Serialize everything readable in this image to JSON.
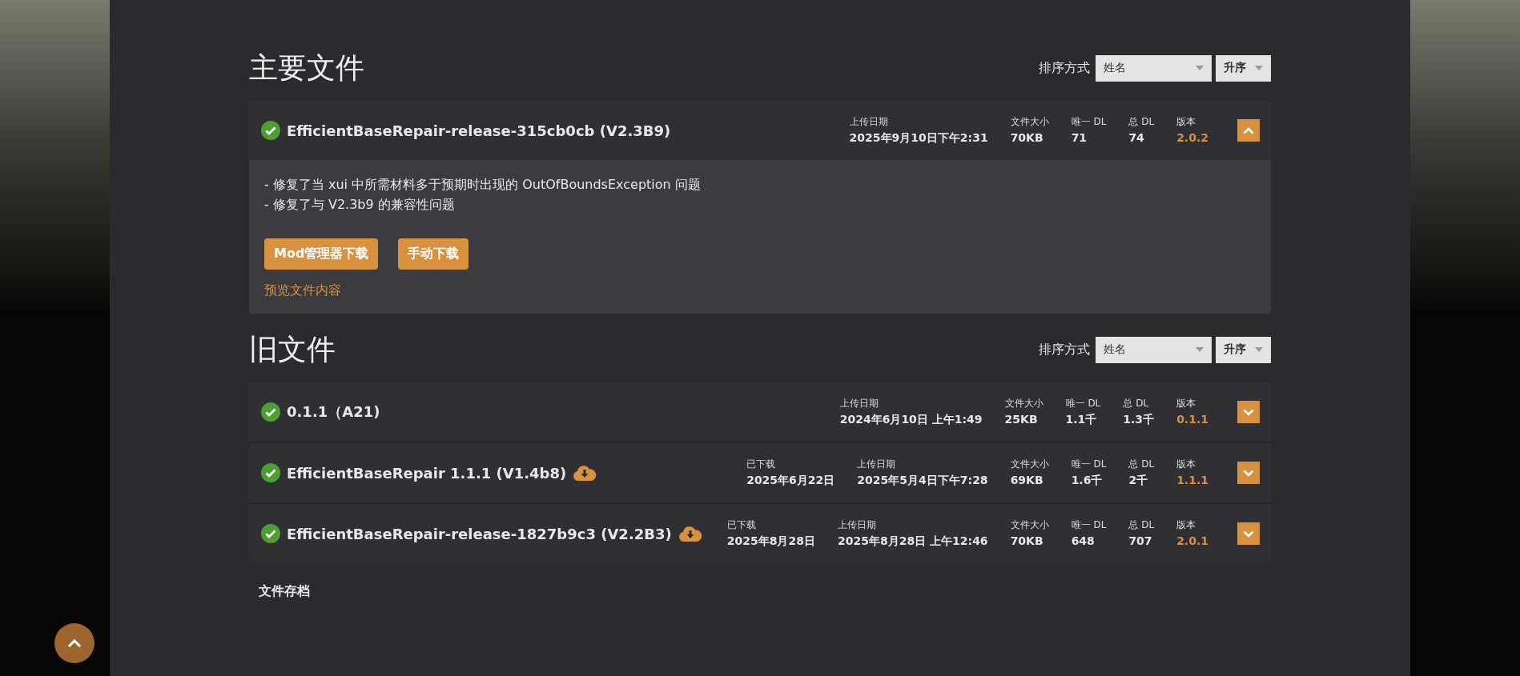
{
  "sections": [
    {
      "title": "主要文件",
      "sort": {
        "label": "排序方式",
        "field": "姓名",
        "order": "升序"
      },
      "files": [
        {
          "name": "EfficientBaseRepair-release-315cb0cb (V2.3B9)",
          "downloaded": false,
          "expanded": true,
          "meta": [
            {
              "kind": "text",
              "label": "上传日期",
              "value": "2025年9月10日下午2:31"
            },
            {
              "kind": "text",
              "label": "文件大小",
              "value": "70KB"
            },
            {
              "kind": "text",
              "label": "唯一 DL",
              "value": "71"
            },
            {
              "kind": "text",
              "label": "总 DL",
              "value": "74"
            },
            {
              "kind": "version",
              "label": "版本",
              "value": "2.0.2"
            }
          ],
          "description": [
            "- 修复了当 xui 中所需材料多于预期时出现的 OutOfBoundsException 问题",
            "- 修复了与 V2.3b9 的兼容性问题"
          ],
          "buttons": [
            "Mod管理器下载",
            "手动下载"
          ],
          "preview_link": "预览文件内容"
        }
      ]
    },
    {
      "title": "旧文件",
      "sort": {
        "label": "排序方式",
        "field": "姓名",
        "order": "升序"
      },
      "files": [
        {
          "name": "0.1.1（A21)",
          "downloaded": false,
          "expanded": false,
          "meta": [
            {
              "kind": "text",
              "label": "上传日期",
              "value": "2024年6月10日 上午1:49"
            },
            {
              "kind": "text",
              "label": "文件大小",
              "value": "25KB"
            },
            {
              "kind": "text",
              "label": "唯一 DL",
              "value": "1.1千"
            },
            {
              "kind": "text",
              "label": "总 DL",
              "value": "1.3千"
            },
            {
              "kind": "version",
              "label": "版本",
              "value": "0.1.1"
            }
          ]
        },
        {
          "name": "EfficientBaseRepair 1.1.1 (V1.4b8)",
          "downloaded": true,
          "expanded": false,
          "meta": [
            {
              "kind": "text",
              "label": "已下载",
              "value": "2025年6月22日"
            },
            {
              "kind": "text",
              "label": "上传日期",
              "value": "2025年5月4日下午7:28"
            },
            {
              "kind": "text",
              "label": "文件大小",
              "value": "69KB"
            },
            {
              "kind": "text",
              "label": "唯一 DL",
              "value": "1.6千"
            },
            {
              "kind": "text",
              "label": "总 DL",
              "value": "2千"
            },
            {
              "kind": "version",
              "label": "版本",
              "value": "1.1.1"
            }
          ]
        },
        {
          "name": "EfficientBaseRepair-release-1827b9c3 (V2.2B3)",
          "downloaded": true,
          "expanded": false,
          "meta": [
            {
              "kind": "text",
              "label": "已下载",
              "value": "2025年8月28日"
            },
            {
              "kind": "text",
              "label": "上传日期",
              "value": "2025年8月28日 上午12:46"
            },
            {
              "kind": "text",
              "label": "文件大小",
              "value": "70KB"
            },
            {
              "kind": "text",
              "label": "唯一 DL",
              "value": "648"
            },
            {
              "kind": "text",
              "label": "总 DL",
              "value": "707"
            },
            {
              "kind": "version",
              "label": "版本",
              "value": "2.0.1"
            }
          ]
        }
      ]
    }
  ],
  "archive_link": "文件存档"
}
